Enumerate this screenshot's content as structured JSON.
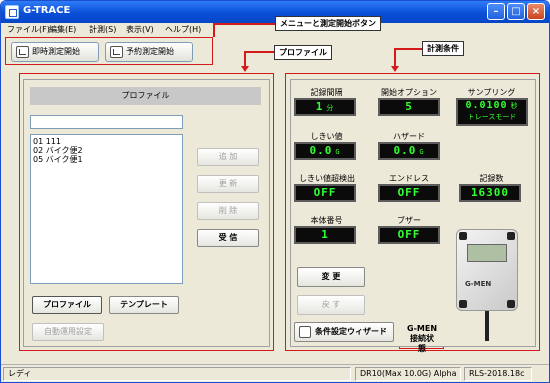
{
  "window": {
    "title": "G-TRACE"
  },
  "menu": {
    "items": [
      "ファイル(F)",
      "編集(E)",
      "計測(S)",
      "表示(V)",
      "ヘルプ(H)"
    ]
  },
  "toolbar": {
    "instant_label": "即時測定開始",
    "scheduled_label": "予約測定開始"
  },
  "callouts": {
    "menu_toolbar": "メニューと測定開始ボタン",
    "profile": "プロファイル",
    "conditions": "計測条件",
    "gmen": "G-MEN\n接続状態"
  },
  "profile_panel": {
    "title": "プロファイル",
    "name_value": "",
    "items": [
      "01 111",
      "02 バイク便2",
      "05 バイク便1"
    ],
    "buttons": {
      "add": "追 加",
      "update": "更 新",
      "delete": "削 除",
      "receive": "受 信"
    },
    "profile_button": "プロファイル",
    "template_button": "テンプレート",
    "auto_button": "自動運用設定"
  },
  "conditions_panel": {
    "params": [
      {
        "label": "記録間隔",
        "value": "1",
        "unit": "分"
      },
      {
        "label": "開始オプション",
        "value": "5",
        "unit": ""
      },
      {
        "label": "サンプリング",
        "value": "0.0100",
        "unit": "秒",
        "sub": "トレースモード"
      },
      {
        "label": "しきい値",
        "value": "0.0",
        "unit": "G"
      },
      {
        "label": "ハザード",
        "value": "0.0",
        "unit": "G"
      },
      {
        "label": "しきい値超検出",
        "value": "OFF",
        "unit": ""
      },
      {
        "label": "エンドレス",
        "value": "OFF",
        "unit": ""
      },
      {
        "label": "記録数",
        "value": "16300",
        "unit": ""
      },
      {
        "label": "本体番号",
        "value": "1",
        "unit": ""
      },
      {
        "label": "ブザー",
        "value": "OFF",
        "unit": ""
      }
    ],
    "change_button": "変 更",
    "revert_button": "戻 す",
    "wizard_button": "条件設定ウィザード",
    "device_brand": "G-MEN"
  },
  "statusbar": {
    "ready": "レディ",
    "model": "DR10(Max 10.0G) Alpha",
    "version": "RLS-2018.18c"
  }
}
